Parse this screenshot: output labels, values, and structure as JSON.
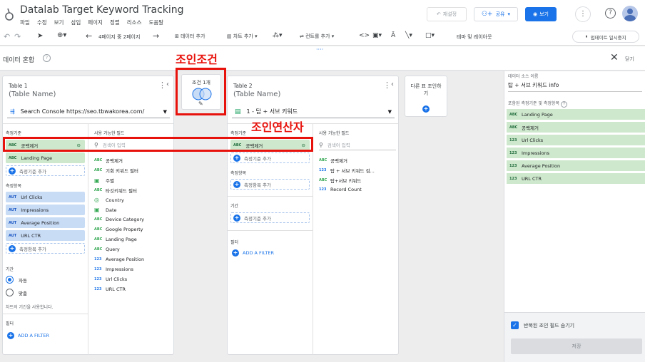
{
  "app": {
    "title": "Datalab Target Keyword Tracking",
    "menu": [
      "파일",
      "수정",
      "보기",
      "삽입",
      "페이지",
      "정렬",
      "리소스",
      "도움말"
    ],
    "reset_label": "재설정",
    "share_label": "공유",
    "view_label": "보기"
  },
  "toolbar": {
    "page_indicator": "4페이지 중 2페이지",
    "add_data": "데이터 추가",
    "add_chart": "차트 추가",
    "add_control": "컨트롤 추가",
    "theme_layout": "테마 및 레이아웃",
    "pause_updates": "업데이트 일시중지"
  },
  "blend": {
    "title": "데이터 혼합",
    "close_label": "닫기"
  },
  "annotations": {
    "join_condition": "조인조건",
    "join_operator": "조인연산자"
  },
  "table1": {
    "title": "Table 1",
    "subtitle": "(Table Name)",
    "source": "Search Console https://seo.tbwakorea.com/",
    "dimensions_label": "측정기준",
    "dimensions": [
      {
        "tag": "ABC",
        "name": "공백제거"
      },
      {
        "tag": "ABC",
        "name": "Landing Page"
      }
    ],
    "add_dimension": "측정기준 추가",
    "metrics_label": "측정항목",
    "metrics": [
      {
        "tag": "AUT",
        "name": "Url Clicks"
      },
      {
        "tag": "AUT",
        "name": "Impressions"
      },
      {
        "tag": "AUT",
        "name": "Average Position"
      },
      {
        "tag": "AUT",
        "name": "URL CTR"
      }
    ],
    "add_metric": "측정항목 추가",
    "date_range_label": "기간",
    "radio_auto": "자동",
    "radio_custom": "맞춤",
    "date_note": "차트의 기간을 사용합니다.",
    "filter_label": "필터",
    "add_filter": "ADD A FILTER",
    "available_fields_label": "사용 가능한 필드",
    "search_placeholder": "검색어 입력",
    "fields": [
      {
        "tag": "ABC",
        "name": "공백제거"
      },
      {
        "tag": "ABC",
        "name": "기회 키워드 필터"
      },
      {
        "tag": "CAL",
        "name": "주별"
      },
      {
        "tag": "ABC",
        "name": "타깃키워드 필터"
      },
      {
        "tag": "GEO",
        "name": "Country"
      },
      {
        "tag": "CAL",
        "name": "Date"
      },
      {
        "tag": "ABC",
        "name": "Device Category"
      },
      {
        "tag": "ABC",
        "name": "Google Property"
      },
      {
        "tag": "ABC",
        "name": "Landing Page"
      },
      {
        "tag": "ABC",
        "name": "Query"
      },
      {
        "tag": "123",
        "name": "Average Position"
      },
      {
        "tag": "123",
        "name": "Impressions"
      },
      {
        "tag": "123",
        "name": "Url Clicks"
      },
      {
        "tag": "123",
        "name": "URL CTR"
      }
    ]
  },
  "join": {
    "label": "조건 1개"
  },
  "table2": {
    "title": "Table 2",
    "subtitle": "(Table Name)",
    "source": "1 - 탑 + 서브 키워드",
    "dimensions_label": "측정기준",
    "dimensions": [
      {
        "tag": "ABC",
        "name": "공백제거"
      }
    ],
    "add_dimension": "측정기준 추가",
    "metrics_label": "측정항목",
    "add_metric": "측정항목 추가",
    "date_range_label": "기간",
    "add_date": "측정기준 추가",
    "filter_label": "필터",
    "add_filter": "ADD A FILTER",
    "available_fields_label": "사용 가능한 필드",
    "search_placeholder": "검색어 입력",
    "fields": [
      {
        "tag": "ABC",
        "name": "공백제거"
      },
      {
        "tag": "123",
        "name": "탑 + 서브 키워드 검..."
      },
      {
        "tag": "ABC",
        "name": "탑+서브 키워드"
      },
      {
        "tag": "123",
        "name": "Record Count"
      }
    ]
  },
  "join_another": {
    "label": "다른 표 조인하기"
  },
  "right_panel": {
    "datasource_label": "데이터 소스 이름",
    "datasource_value": "탑 + 서브 키워드 info",
    "fields_label": "포함된 측정기준 및 측정항목",
    "fields": [
      {
        "tag": "ABC",
        "name": "Landing Page"
      },
      {
        "tag": "ABC",
        "name": "공백제거"
      },
      {
        "tag": "123",
        "name": "Url Clicks"
      },
      {
        "tag": "123",
        "name": "Impressions"
      },
      {
        "tag": "123",
        "name": "Average Position"
      },
      {
        "tag": "123",
        "name": "URL CTR"
      }
    ],
    "hide_repeated": "반복된 조인 필드 숨기기",
    "save": "저장"
  }
}
